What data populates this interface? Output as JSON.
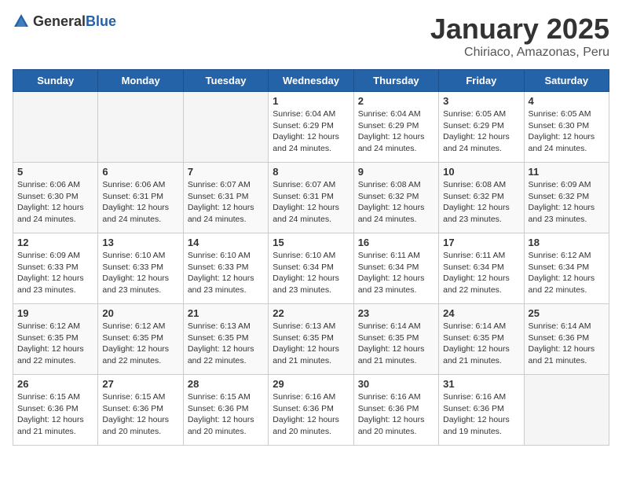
{
  "header": {
    "logo_general": "General",
    "logo_blue": "Blue",
    "title": "January 2025",
    "subtitle": "Chiriaco, Amazonas, Peru"
  },
  "days_of_week": [
    "Sunday",
    "Monday",
    "Tuesday",
    "Wednesday",
    "Thursday",
    "Friday",
    "Saturday"
  ],
  "weeks": [
    [
      {
        "num": "",
        "info": ""
      },
      {
        "num": "",
        "info": ""
      },
      {
        "num": "",
        "info": ""
      },
      {
        "num": "1",
        "info": "Sunrise: 6:04 AM\nSunset: 6:29 PM\nDaylight: 12 hours\nand 24 minutes."
      },
      {
        "num": "2",
        "info": "Sunrise: 6:04 AM\nSunset: 6:29 PM\nDaylight: 12 hours\nand 24 minutes."
      },
      {
        "num": "3",
        "info": "Sunrise: 6:05 AM\nSunset: 6:29 PM\nDaylight: 12 hours\nand 24 minutes."
      },
      {
        "num": "4",
        "info": "Sunrise: 6:05 AM\nSunset: 6:30 PM\nDaylight: 12 hours\nand 24 minutes."
      }
    ],
    [
      {
        "num": "5",
        "info": "Sunrise: 6:06 AM\nSunset: 6:30 PM\nDaylight: 12 hours\nand 24 minutes."
      },
      {
        "num": "6",
        "info": "Sunrise: 6:06 AM\nSunset: 6:31 PM\nDaylight: 12 hours\nand 24 minutes."
      },
      {
        "num": "7",
        "info": "Sunrise: 6:07 AM\nSunset: 6:31 PM\nDaylight: 12 hours\nand 24 minutes."
      },
      {
        "num": "8",
        "info": "Sunrise: 6:07 AM\nSunset: 6:31 PM\nDaylight: 12 hours\nand 24 minutes."
      },
      {
        "num": "9",
        "info": "Sunrise: 6:08 AM\nSunset: 6:32 PM\nDaylight: 12 hours\nand 24 minutes."
      },
      {
        "num": "10",
        "info": "Sunrise: 6:08 AM\nSunset: 6:32 PM\nDaylight: 12 hours\nand 23 minutes."
      },
      {
        "num": "11",
        "info": "Sunrise: 6:09 AM\nSunset: 6:32 PM\nDaylight: 12 hours\nand 23 minutes."
      }
    ],
    [
      {
        "num": "12",
        "info": "Sunrise: 6:09 AM\nSunset: 6:33 PM\nDaylight: 12 hours\nand 23 minutes."
      },
      {
        "num": "13",
        "info": "Sunrise: 6:10 AM\nSunset: 6:33 PM\nDaylight: 12 hours\nand 23 minutes."
      },
      {
        "num": "14",
        "info": "Sunrise: 6:10 AM\nSunset: 6:33 PM\nDaylight: 12 hours\nand 23 minutes."
      },
      {
        "num": "15",
        "info": "Sunrise: 6:10 AM\nSunset: 6:34 PM\nDaylight: 12 hours\nand 23 minutes."
      },
      {
        "num": "16",
        "info": "Sunrise: 6:11 AM\nSunset: 6:34 PM\nDaylight: 12 hours\nand 23 minutes."
      },
      {
        "num": "17",
        "info": "Sunrise: 6:11 AM\nSunset: 6:34 PM\nDaylight: 12 hours\nand 22 minutes."
      },
      {
        "num": "18",
        "info": "Sunrise: 6:12 AM\nSunset: 6:34 PM\nDaylight: 12 hours\nand 22 minutes."
      }
    ],
    [
      {
        "num": "19",
        "info": "Sunrise: 6:12 AM\nSunset: 6:35 PM\nDaylight: 12 hours\nand 22 minutes."
      },
      {
        "num": "20",
        "info": "Sunrise: 6:12 AM\nSunset: 6:35 PM\nDaylight: 12 hours\nand 22 minutes."
      },
      {
        "num": "21",
        "info": "Sunrise: 6:13 AM\nSunset: 6:35 PM\nDaylight: 12 hours\nand 22 minutes."
      },
      {
        "num": "22",
        "info": "Sunrise: 6:13 AM\nSunset: 6:35 PM\nDaylight: 12 hours\nand 21 minutes."
      },
      {
        "num": "23",
        "info": "Sunrise: 6:14 AM\nSunset: 6:35 PM\nDaylight: 12 hours\nand 21 minutes."
      },
      {
        "num": "24",
        "info": "Sunrise: 6:14 AM\nSunset: 6:35 PM\nDaylight: 12 hours\nand 21 minutes."
      },
      {
        "num": "25",
        "info": "Sunrise: 6:14 AM\nSunset: 6:36 PM\nDaylight: 12 hours\nand 21 minutes."
      }
    ],
    [
      {
        "num": "26",
        "info": "Sunrise: 6:15 AM\nSunset: 6:36 PM\nDaylight: 12 hours\nand 21 minutes."
      },
      {
        "num": "27",
        "info": "Sunrise: 6:15 AM\nSunset: 6:36 PM\nDaylight: 12 hours\nand 20 minutes."
      },
      {
        "num": "28",
        "info": "Sunrise: 6:15 AM\nSunset: 6:36 PM\nDaylight: 12 hours\nand 20 minutes."
      },
      {
        "num": "29",
        "info": "Sunrise: 6:16 AM\nSunset: 6:36 PM\nDaylight: 12 hours\nand 20 minutes."
      },
      {
        "num": "30",
        "info": "Sunrise: 6:16 AM\nSunset: 6:36 PM\nDaylight: 12 hours\nand 20 minutes."
      },
      {
        "num": "31",
        "info": "Sunrise: 6:16 AM\nSunset: 6:36 PM\nDaylight: 12 hours\nand 19 minutes."
      },
      {
        "num": "",
        "info": ""
      }
    ]
  ]
}
